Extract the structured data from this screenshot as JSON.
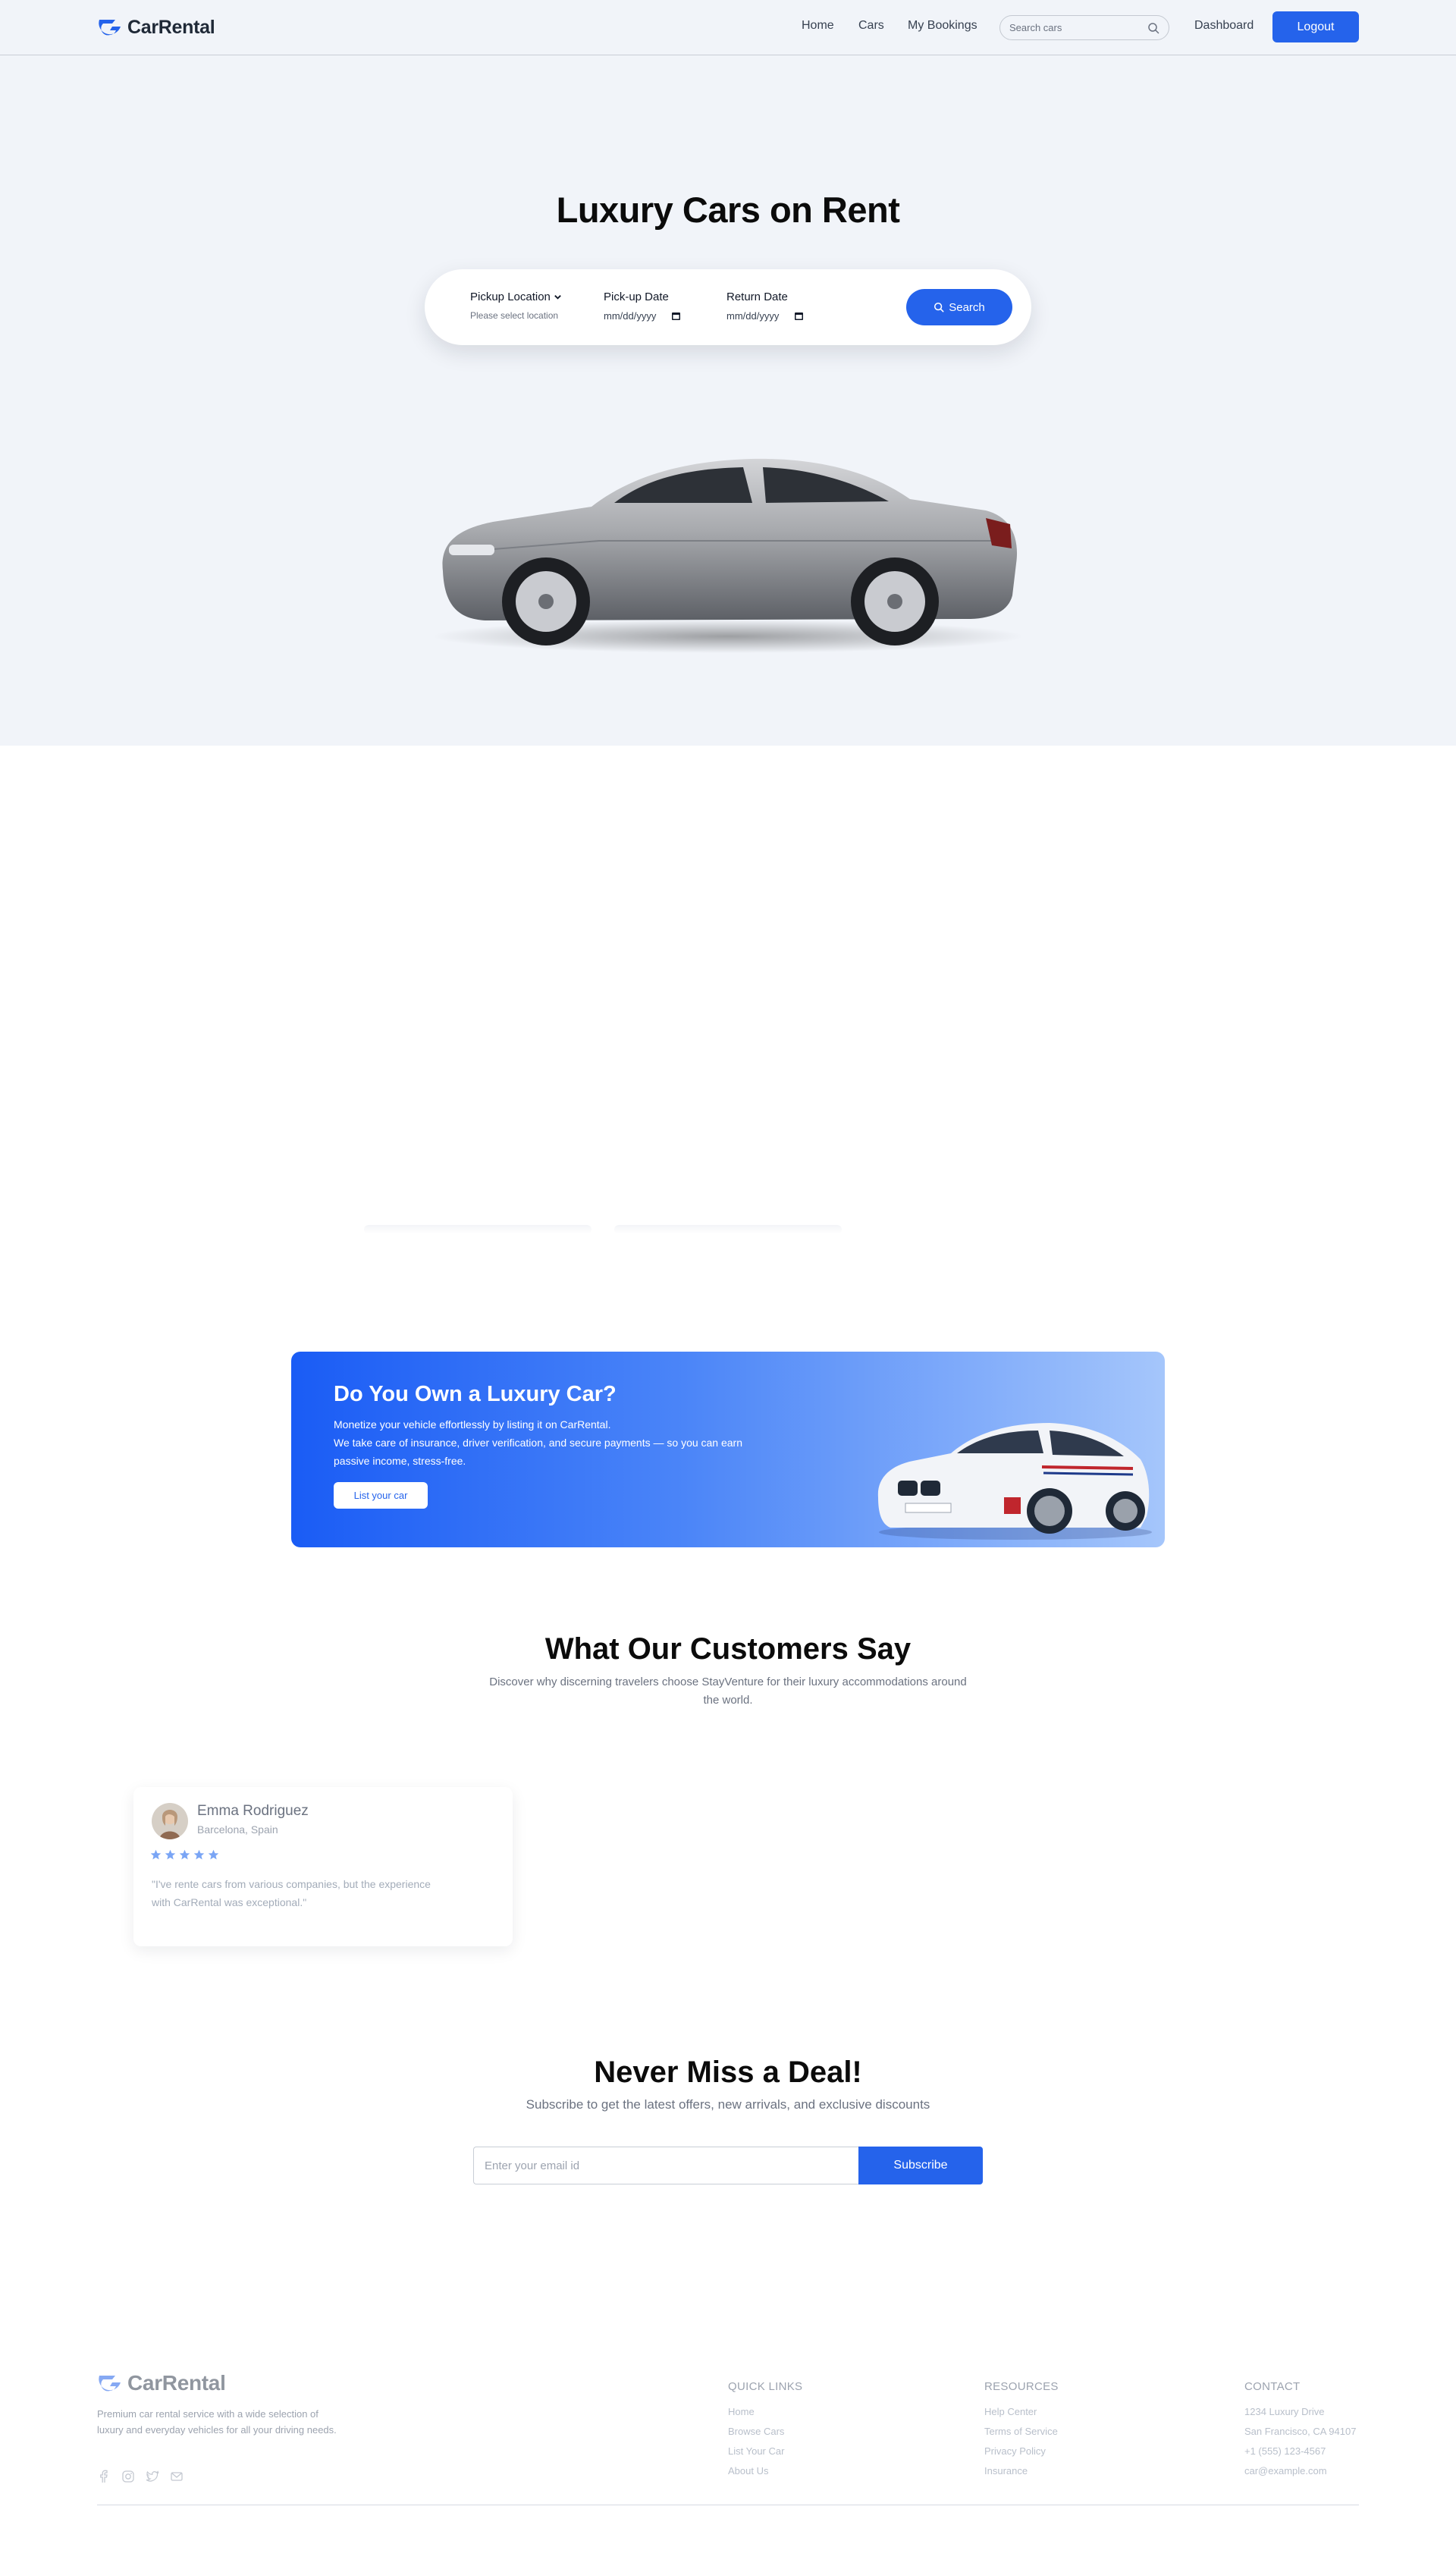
{
  "brand": {
    "name": "CarRental",
    "accent": "#2563eb"
  },
  "nav": {
    "links": [
      "Home",
      "Cars",
      "My Bookings"
    ],
    "search_placeholder": "Search cars",
    "dashboard": "Dashboard",
    "logout": "Logout"
  },
  "hero": {
    "title": "Luxury Cars on Rent",
    "pickup_location_label": "Pickup Location",
    "pickup_location_value": "Please select location",
    "pickup_date_label": "Pick-up Date",
    "pickup_date_placeholder": "mm/dd/yyyy",
    "return_date_label": "Return Date",
    "return_date_placeholder": "mm/dd/yyyy",
    "search_button": "Search"
  },
  "banner": {
    "title": "Do You Own a Luxury Car?",
    "line1": "Monetize your vehicle effortlessly by listing it on CarRental.",
    "line2": "We take care of insurance, driver verification, and secure payments — so you can earn passive income, stress-free.",
    "button": "List your car"
  },
  "testimonials": {
    "title": "What Our Customers Say",
    "subtitle": "Discover why discerning travelers choose StayVenture for their luxury accommodations around the world.",
    "items": [
      {
        "name": "Emma Rodriguez",
        "location": "Barcelona, Spain",
        "rating": 5,
        "quote": "\"I've rente cars from various companies, but the experience with CarRental was exceptional.\""
      }
    ]
  },
  "newsletter": {
    "title": "Never Miss a Deal!",
    "subtitle": "Subscribe to get the latest offers, new arrivals, and exclusive discounts",
    "placeholder": "Enter your email id",
    "button": "Subscribe"
  },
  "footer": {
    "description": "Premium car rental service with a wide selection of luxury and everyday vehicles for all your driving needs.",
    "quick_links": {
      "heading": "QUICK LINKS",
      "items": [
        "Home",
        "Browse Cars",
        "List Your Car",
        "About Us"
      ]
    },
    "resources": {
      "heading": "RESOURCES",
      "items": [
        "Help Center",
        "Terms of Service",
        "Privacy Policy",
        "Insurance"
      ]
    },
    "contact": {
      "heading": "CONTACT",
      "items": [
        "1234 Luxury Drive",
        "San Francisco, CA 94107",
        "+1 (555) 123-4567",
        "car@example.com"
      ]
    },
    "social_icons": [
      "facebook-icon",
      "instagram-icon",
      "twitter-icon",
      "mail-icon"
    ]
  }
}
